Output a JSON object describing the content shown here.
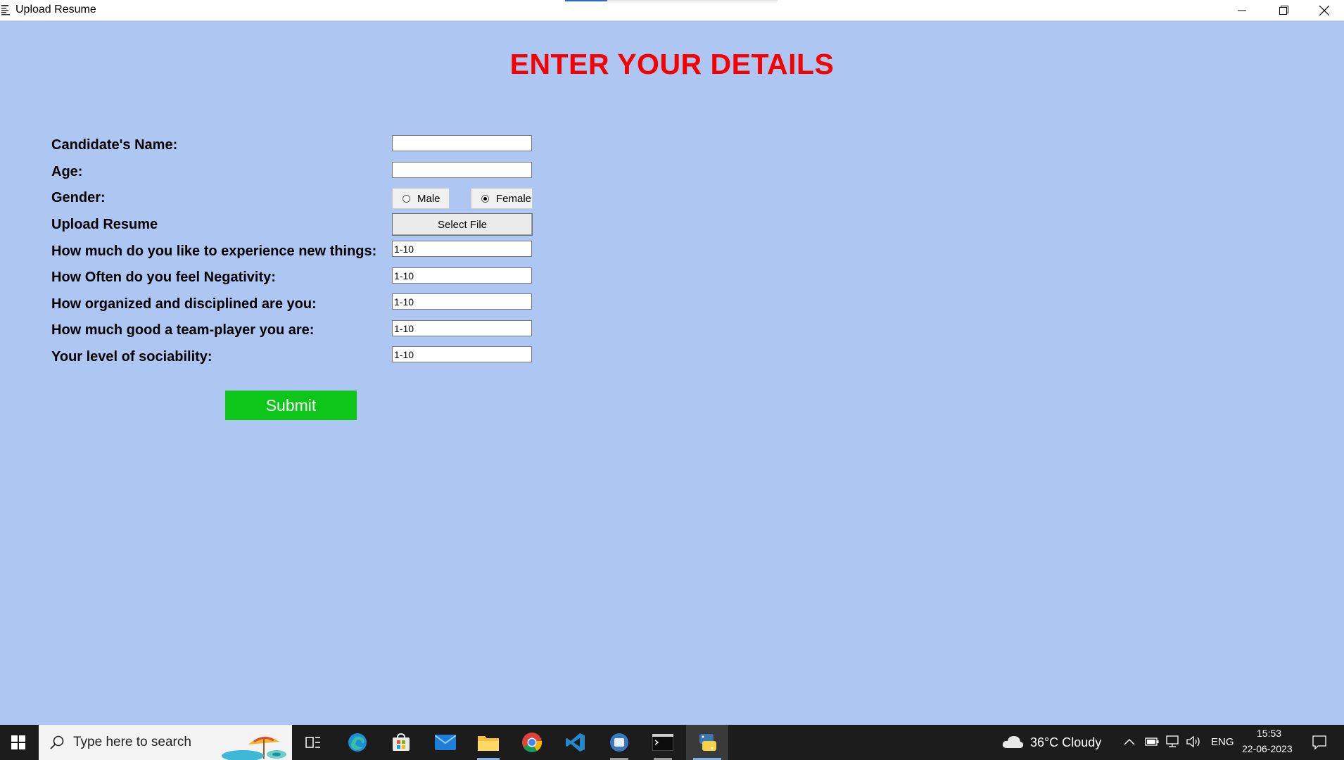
{
  "window": {
    "title": "Upload Resume",
    "progress": 0.2
  },
  "form": {
    "heading": "ENTER YOUR DETAILS",
    "name": {
      "label": "Candidate's Name:",
      "value": ""
    },
    "age": {
      "label": "Age:",
      "value": ""
    },
    "gender": {
      "label": "Gender:",
      "options": [
        "Male",
        "Female"
      ],
      "selected": "Female"
    },
    "resume": {
      "label": "Upload Resume",
      "button": "Select File"
    },
    "questions": [
      {
        "label": "How much do you like to experience new things:",
        "value": "1-10"
      },
      {
        "label": "How Often do you feel Negativity:",
        "value": "1-10"
      },
      {
        "label": "How organized and disciplined are you:",
        "value": "1-10"
      },
      {
        "label": "How much good a team-player you are:",
        "value": "1-10"
      },
      {
        "label": "Your level of sociability:",
        "value": "1-10"
      }
    ],
    "submit": "Submit"
  },
  "taskbar": {
    "search_placeholder": "Type here to search",
    "weather": "36°C  Cloudy",
    "language": "ENG",
    "time": "15:53",
    "date": "22-06-2023",
    "apps": [
      "start-icon",
      "task-view-icon",
      "edge-icon",
      "store-icon",
      "mail-icon",
      "file-explorer-icon",
      "chrome-icon",
      "vscode-icon",
      "app-icon",
      "terminal-icon",
      "python-icon"
    ]
  },
  "colors": {
    "background": "#aec6f2",
    "heading": "#f70000",
    "submit": "#0ec51a"
  }
}
